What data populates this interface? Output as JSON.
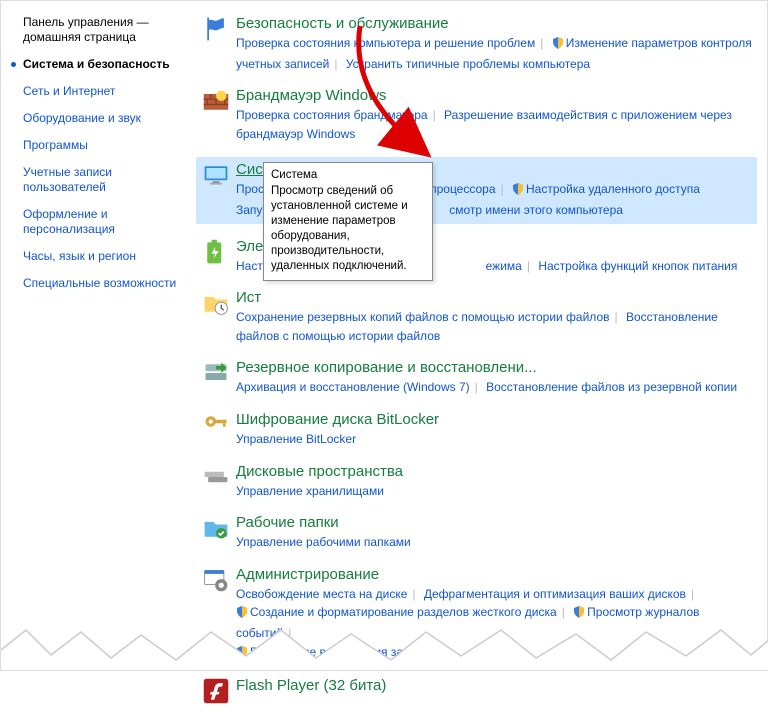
{
  "sidebar": {
    "home": "Панель управления — домашняя страница",
    "items": [
      "Система и безопасность",
      "Сеть и Интернет",
      "Оборудование и звук",
      "Программы",
      "Учетные записи пользователей",
      "Оформление и персонализация",
      "Часы, язык и регион",
      "Специальные возможности"
    ],
    "activeIndex": 0
  },
  "tooltip": {
    "title": "Система",
    "body": "Просмотр сведений об установленной системе и изменение параметров оборудования, производительности, удаленных подключений."
  },
  "categories": [
    {
      "title": "Безопасность и обслуживание",
      "links": [
        {
          "t": "Проверка состояния компьютера и решение проблем"
        },
        {
          "t": "Изменение параметров контроля учетных записей",
          "shield": true
        },
        {
          "t": "Устранить типичные проблемы компьютера"
        }
      ]
    },
    {
      "title": "Брандмауэр Windows",
      "links": [
        {
          "t": "Проверка состояния брандмауэра"
        },
        {
          "t": "Разрешение взаимодействия с приложением через брандмауэр Windows"
        }
      ]
    },
    {
      "title": "Система",
      "highlight": true,
      "links": [
        {
          "t": "Просмотр объема ОЗУ и скорости процессора"
        },
        {
          "t": "Настройка удаленного доступа",
          "shield": true
        },
        {
          "t": "Запуск удаленного помощника"
        },
        {
          "t": "Просмотр имени этого компьютера"
        }
      ],
      "note_row2_start_index": 2
    },
    {
      "title": "Электропитание",
      "truncated": true,
      "links": [
        {
          "t": "Настройка перехода в спящий режим",
          "clip": "Настро"
        },
        {
          "t": "Изменение режима"
        },
        {
          "t": "Настройка функций кнопок питания"
        }
      ]
    },
    {
      "title": "История файлов",
      "truncated": true,
      "links": [
        {
          "t": "Сохранение резервных копий файлов с помощью истории файлов"
        },
        {
          "t": "Восстановление файлов с помощью истории файлов"
        }
      ]
    },
    {
      "title": "Резервное копирование и восстановлени...",
      "links": [
        {
          "t": "Архивация и восстановление (Windows 7)"
        },
        {
          "t": "Восстановление файлов из резервной копии"
        }
      ]
    },
    {
      "title": "Шифрование диска BitLocker",
      "links": [
        {
          "t": "Управление BitLocker"
        }
      ]
    },
    {
      "title": "Дисковые пространства",
      "links": [
        {
          "t": "Управление хранилищами"
        }
      ]
    },
    {
      "title": "Рабочие папки",
      "links": [
        {
          "t": "Управление рабочими папками"
        }
      ]
    },
    {
      "title": "Администрирование",
      "links": [
        {
          "t": "Освобождение места на диске"
        },
        {
          "t": "Дефрагментация и оптимизация ваших дисков"
        },
        {
          "t": "Создание и форматирование разделов жесткого диска",
          "shield": true
        },
        {
          "t": "Просмотр журналов событий",
          "shield": true
        },
        {
          "t": "Расписание выполнения задач",
          "shield": true
        }
      ]
    },
    {
      "title": "Flash Player (32 бита)",
      "links": []
    }
  ],
  "icons": {
    "security": "flag",
    "firewall": "brick-wall",
    "system": "monitor",
    "power": "battery",
    "filehist": "folder-clock",
    "backup": "drive-arrow",
    "bitlocker": "key",
    "storage": "disks",
    "workfolders": "folder-green",
    "admin": "gear-window",
    "flash": "flash"
  }
}
